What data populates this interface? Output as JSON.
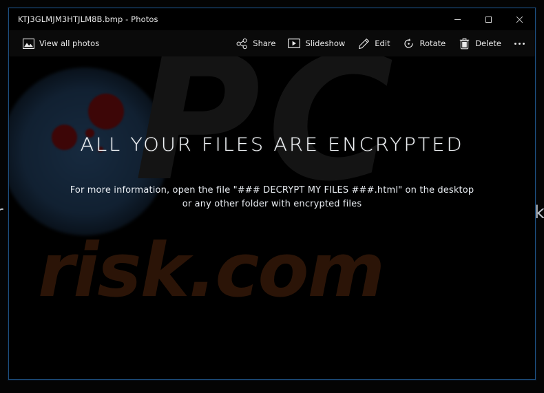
{
  "window": {
    "title": "KTJ3GLMJM3HTJLM8B.bmp - Photos",
    "controls": {
      "minimize_label": "Minimize",
      "maximize_label": "Maximize",
      "close_label": "Close"
    },
    "border_color": "#1d4e7e"
  },
  "commandbar": {
    "view_all_photos": "View all photos",
    "share": "Share",
    "slideshow": "Slideshow",
    "edit": "Edit",
    "rotate": "Rotate",
    "delete": "Delete",
    "more": "…"
  },
  "note": {
    "headline": "ALL YOUR FILES ARE ENCRYPTED",
    "body_line1": "For more information, open the file \"### DECRYPT MY FILES ###.html\" on the desktop",
    "body_line2": "or any other folder with encrypted files",
    "watermark_top": "PC",
    "watermark_bottom": "risk.com",
    "headline_color": "#f2f5f8",
    "body_color": "#e9edf2",
    "watermark_bottom_color": "#2b1407",
    "glow_color": "#182c42",
    "blood_color": "#3d0607",
    "background_color": "#000000"
  },
  "desktop": {
    "wallpaper_text_left": "r",
    "wallpaper_text_right": "k",
    "background_color": "#040404"
  }
}
